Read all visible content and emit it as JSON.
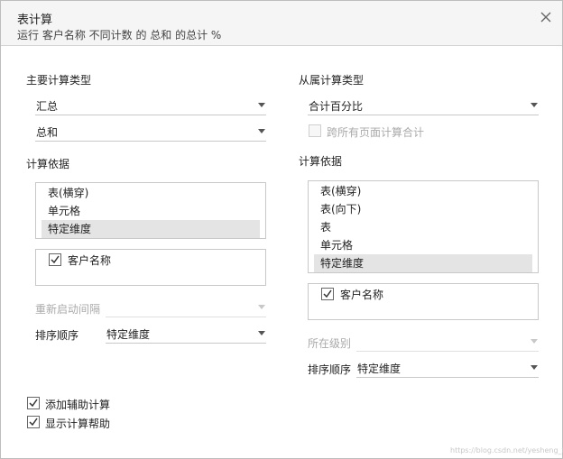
{
  "dialog": {
    "title": "表计算",
    "subtitle": "运行 客户名称 不同计数 的 总和 的总计 %"
  },
  "primary": {
    "section_label": "主要计算类型",
    "calc_type": "汇总",
    "aggregation": "总和",
    "compute_label": "计算依据",
    "compute_options": [
      "表(横穿)",
      "单元格",
      "特定维度"
    ],
    "selected_index": 2,
    "dimension_label": "客户名称",
    "restart_label": "重新启动间隔",
    "restart_value": "",
    "sort_label": "排序顺序",
    "sort_value": "特定维度"
  },
  "secondary": {
    "section_label": "从属计算类型",
    "calc_type": "合计百分比",
    "across_pages_label": "跨所有页面计算合计",
    "compute_label": "计算依据",
    "compute_options": [
      "表(横穿)",
      "表(向下)",
      "表",
      "单元格",
      "特定维度"
    ],
    "selected_index": 4,
    "dimension_label": "客户名称",
    "level_label": "所在级别",
    "level_value": "",
    "sort_label": "排序顺序",
    "sort_value": "特定维度"
  },
  "footer": {
    "add_secondary_label": "添加辅助计算",
    "show_help_label": "显示计算帮助"
  },
  "watermark": "https://blog.csdn.net/yesheng_tidy"
}
